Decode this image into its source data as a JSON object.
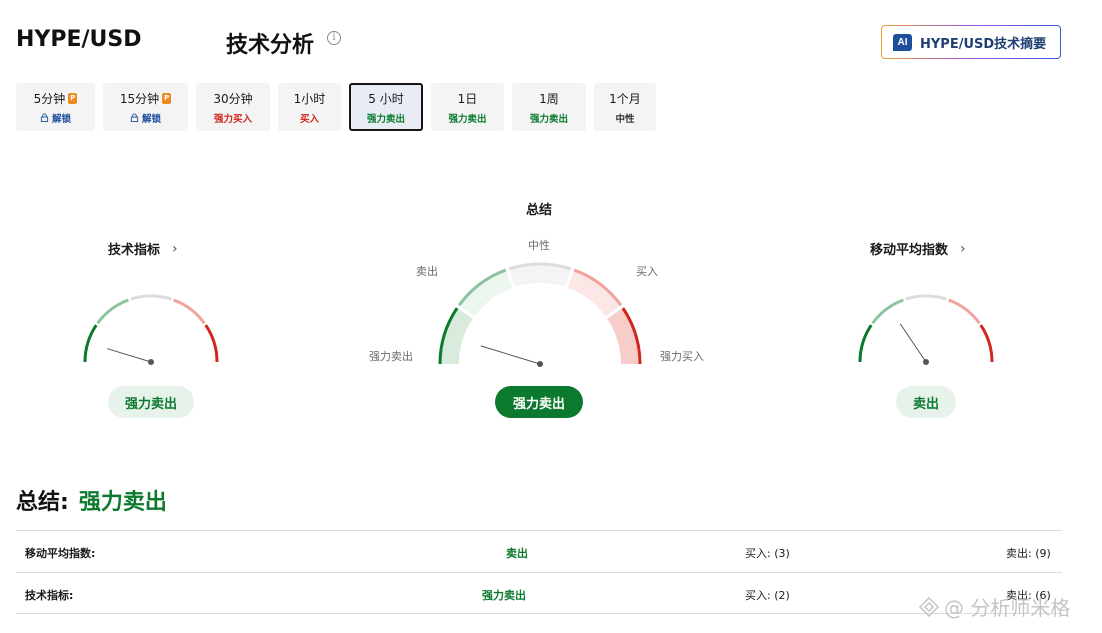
{
  "header": {
    "pair": "HYPE/USD",
    "title": "技术分析",
    "info_icon": "i",
    "ai_badge": "AI",
    "ai_button": "HYPE/USD技术摘要"
  },
  "tabs": [
    {
      "label": "5分钟",
      "pro": "P",
      "status": "解锁",
      "kind": "lock"
    },
    {
      "label": "15分钟",
      "pro": "P",
      "status": "解锁",
      "kind": "lock"
    },
    {
      "label": "30分钟",
      "status": "强力买入",
      "kind": "buy"
    },
    {
      "label": "1小时",
      "status": "买入",
      "kind": "buy"
    },
    {
      "label": "5 小时",
      "status": "强力卖出",
      "kind": "sell",
      "active": true
    },
    {
      "label": "1日",
      "status": "强力卖出",
      "kind": "sell"
    },
    {
      "label": "1周",
      "status": "强力卖出",
      "kind": "sell"
    },
    {
      "label": "1个月",
      "status": "中性",
      "kind": "neutral"
    }
  ],
  "gauges": {
    "tech": {
      "title": "技术指标",
      "chevron": "›",
      "result": "强力卖出",
      "needle_angle_deg": -17
    },
    "summary": {
      "title": "总结",
      "labels": {
        "strong_sell": "强力卖出",
        "sell": "卖出",
        "neutral": "中性",
        "buy": "买入",
        "strong_buy": "强力买入"
      },
      "result": "强力卖出",
      "needle_angle_deg": -17
    },
    "ma": {
      "title": "移动平均指数",
      "chevron": "›",
      "result": "卖出",
      "needle_angle_deg": -56
    }
  },
  "summary": {
    "label": "总结:",
    "value": "强力卖出",
    "rows": [
      {
        "label": "移动平均指数:",
        "value": "卖出",
        "buy": "买入: (3)",
        "sell": "卖出: (9)"
      },
      {
        "label": "技术指标:",
        "value": "强力卖出",
        "buy": "买入: (2)",
        "sell": "卖出: (6)"
      }
    ]
  },
  "watermark": "@ 分析师米格",
  "colors": {
    "strong_sell": "#0b7a2e",
    "sell": "#8cc49f",
    "neutral": "#dcdcdc",
    "buy": "#f0a29c",
    "strong_buy": "#d0261c"
  }
}
